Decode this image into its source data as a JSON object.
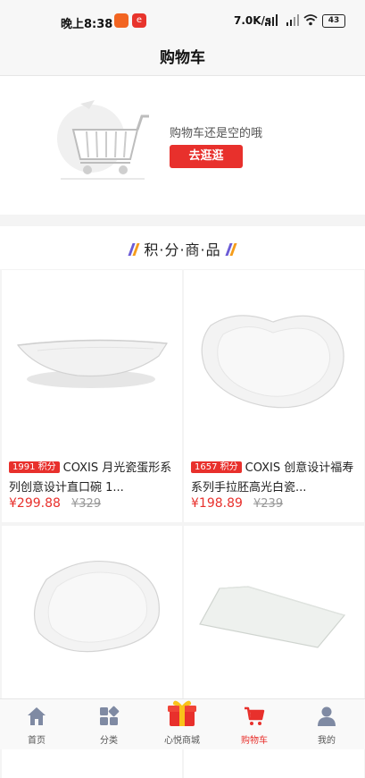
{
  "status_bar": {
    "time": "晚上8:38",
    "app_icon": "e",
    "net_speed": "7.0K/s",
    "battery": "43"
  },
  "header": {
    "title": "购物车"
  },
  "empty_cart": {
    "message": "购物车还是空的哦",
    "button": "去逛逛"
  },
  "section": {
    "title": "积·分·商·品"
  },
  "products": [
    {
      "points": "1991 积分",
      "name": "COXIS 月光瓷蛋形系列创意设计直口碗 1...",
      "price": "¥299.88",
      "old_price": "¥329"
    },
    {
      "points": "1657 积分",
      "name": "COXIS 创意设计福寿系列手拉胚高光白瓷...",
      "price": "¥198.89",
      "old_price": "¥239"
    },
    {
      "points": "",
      "name": "",
      "price": "",
      "old_price": ""
    },
    {
      "points": "",
      "name": "",
      "price": "",
      "old_price": ""
    }
  ],
  "nav": {
    "items": [
      {
        "label": "首页",
        "icon": "home-icon"
      },
      {
        "label": "分类",
        "icon": "category-icon"
      },
      {
        "label": "心悦商城",
        "icon": "gift-icon"
      },
      {
        "label": "购物车",
        "icon": "cart-icon"
      },
      {
        "label": "我的",
        "icon": "user-icon"
      }
    ],
    "active": "购物车"
  },
  "colors": {
    "accent": "#e8302c",
    "badge": "#e8302c",
    "background": "#f4f4f4"
  }
}
